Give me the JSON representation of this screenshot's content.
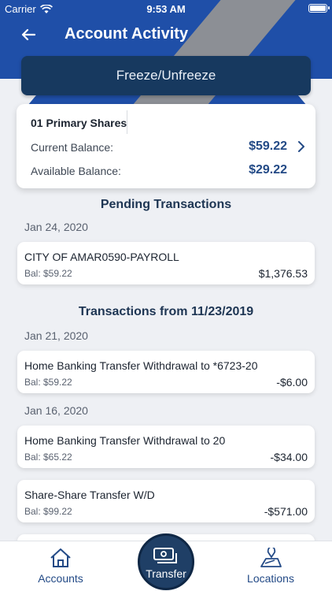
{
  "status": {
    "carrier": "Carrier",
    "time": "9:53 AM"
  },
  "nav": {
    "title": "Account Activity"
  },
  "freeze_button": {
    "label": "Freeze/Unfreeze"
  },
  "account": {
    "name": "01 Primary Shares",
    "current_label": "Current Balance:",
    "current_value": "$59.22",
    "available_label": "Available Balance:",
    "available_value": "$29.22"
  },
  "pending": {
    "title": "Pending Transactions",
    "date": "Jan 24, 2020",
    "items": [
      {
        "desc": "CITY OF AMAR0590-PAYROLL",
        "bal": "Bal: $59.22",
        "amount": "$1,376.53"
      }
    ]
  },
  "transactions": {
    "title": "Transactions from 11/23/2019",
    "groups": [
      {
        "date": "Jan 21, 2020",
        "items": [
          {
            "desc": "Home Banking Transfer Withdrawal  to  *6723-20",
            "bal": "Bal: $59.22",
            "amount": "-$6.00"
          }
        ]
      },
      {
        "date": "Jan 16, 2020",
        "items": [
          {
            "desc": "Home Banking Transfer Withdrawal  to 20",
            "bal": "Bal: $65.22",
            "amount": "-$34.00"
          },
          {
            "desc": "Share-Share Transfer W/D",
            "bal": "Bal: $99.22",
            "amount": "-$571.00"
          }
        ]
      }
    ]
  },
  "tabbar": {
    "accounts": "Accounts",
    "transfer": "Transfer",
    "locations": "Locations"
  },
  "colors": {
    "brand_blue": "#1f4fa8",
    "navy": "#17395f",
    "accent_text": "#234a86"
  }
}
